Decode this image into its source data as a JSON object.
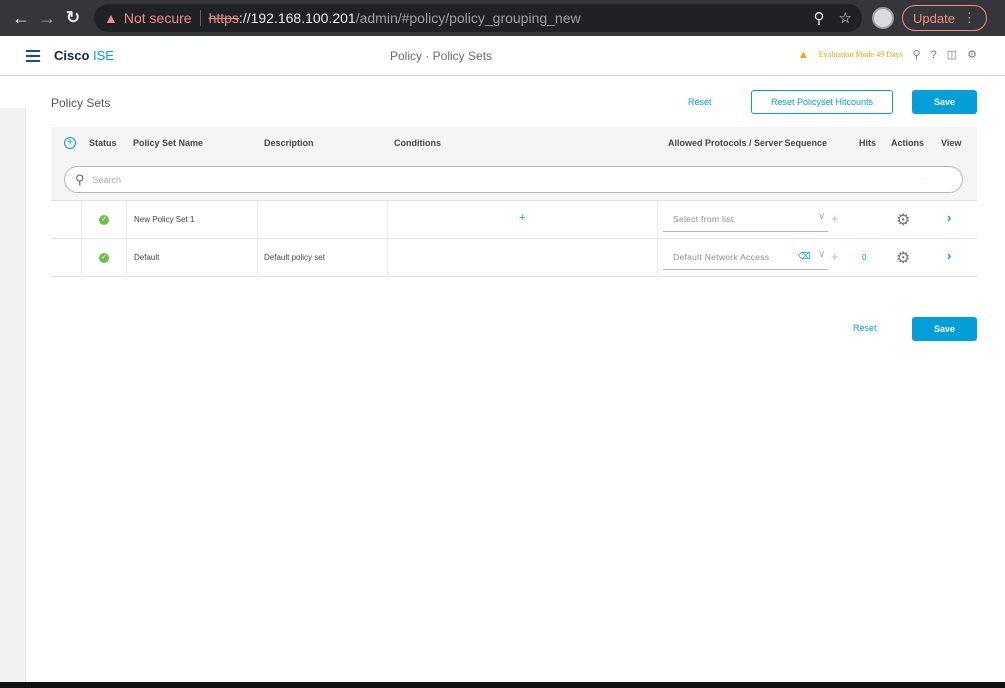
{
  "browser": {
    "not_secure": "Not secure",
    "url_scheme": "https",
    "url_host": "://192.168.100.201",
    "url_path": "/admin/#policy/policy_grouping_new",
    "update_label": "Update"
  },
  "header": {
    "brand_bold": "Cisco",
    "brand_rest": " ISE",
    "title": "Policy · Policy Sets",
    "evaluation": "Evaluation Mode 49 Days"
  },
  "toolbar": {
    "section_title": "Policy Sets",
    "reset_label": "Reset",
    "reset_hitcounts_label": "Reset Policyset Hitcounts",
    "save_label": "Save"
  },
  "table": {
    "columns": [
      "Status",
      "Policy Set Name",
      "Description",
      "Conditions",
      "Allowed Protocols / Server Sequence",
      "Hits",
      "Actions",
      "View"
    ],
    "search_placeholder": "Search",
    "rows": [
      {
        "name": "New Policy Set 1",
        "description": "",
        "protocol": "Select from list",
        "hits": ""
      },
      {
        "name": "Default",
        "description": "Default policy set",
        "protocol": "Default Network Access",
        "hits": "0"
      }
    ]
  },
  "footer": {
    "reset_label": "Reset",
    "save_label": "Save"
  },
  "colors": {
    "accent": "#049fd9",
    "status_ok": "#6cc04a",
    "warning": "#f0a800"
  }
}
